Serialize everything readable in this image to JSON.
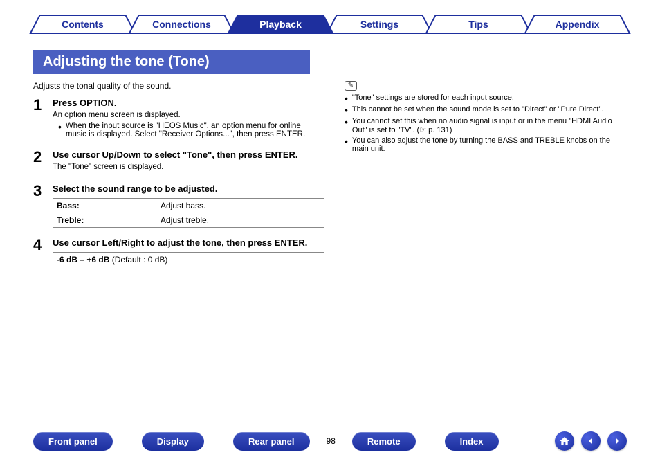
{
  "nav": {
    "tabs": [
      {
        "label": "Contents",
        "active": false
      },
      {
        "label": "Connections",
        "active": false
      },
      {
        "label": "Playback",
        "active": true
      },
      {
        "label": "Settings",
        "active": false
      },
      {
        "label": "Tips",
        "active": false
      },
      {
        "label": "Appendix",
        "active": false
      }
    ]
  },
  "section": {
    "title": "Adjusting the tone (Tone)",
    "intro": "Adjusts the tonal quality of the sound."
  },
  "steps": [
    {
      "num": "1",
      "title": "Press OPTION.",
      "desc": "An option menu screen is displayed.",
      "bullets": [
        "When the input source is \"HEOS Music\", an option menu for online music is displayed. Select \"Receiver Options...\", then press ENTER."
      ]
    },
    {
      "num": "2",
      "title": "Use cursor Up/Down to select \"Tone\", then press ENTER.",
      "desc": "The \"Tone\" screen is displayed."
    },
    {
      "num": "3",
      "title": "Select the sound range to be adjusted.",
      "table": [
        {
          "k": "Bass:",
          "v": "Adjust bass."
        },
        {
          "k": "Treble:",
          "v": "Adjust treble."
        }
      ]
    },
    {
      "num": "4",
      "title": "Use cursor Left/Right to adjust the tone, then press ENTER.",
      "range_bold": "-6 dB – +6 dB",
      "range_rest": " (Default : 0 dB)"
    }
  ],
  "notes": [
    "\"Tone\" settings are stored for each input source.",
    "This cannot be set when the sound mode is set to \"Direct\" or \"Pure Direct\".",
    "You cannot set this when no audio signal is input or in the menu \"HDMI Audio Out\" is set to \"TV\".  (☞ p. 131)",
    "You can also adjust the tone by turning the BASS and TREBLE knobs on the main unit."
  ],
  "bottom": {
    "pills": [
      "Front panel",
      "Display",
      "Rear panel"
    ],
    "page": "98",
    "pills2": [
      "Remote",
      "Index"
    ]
  }
}
